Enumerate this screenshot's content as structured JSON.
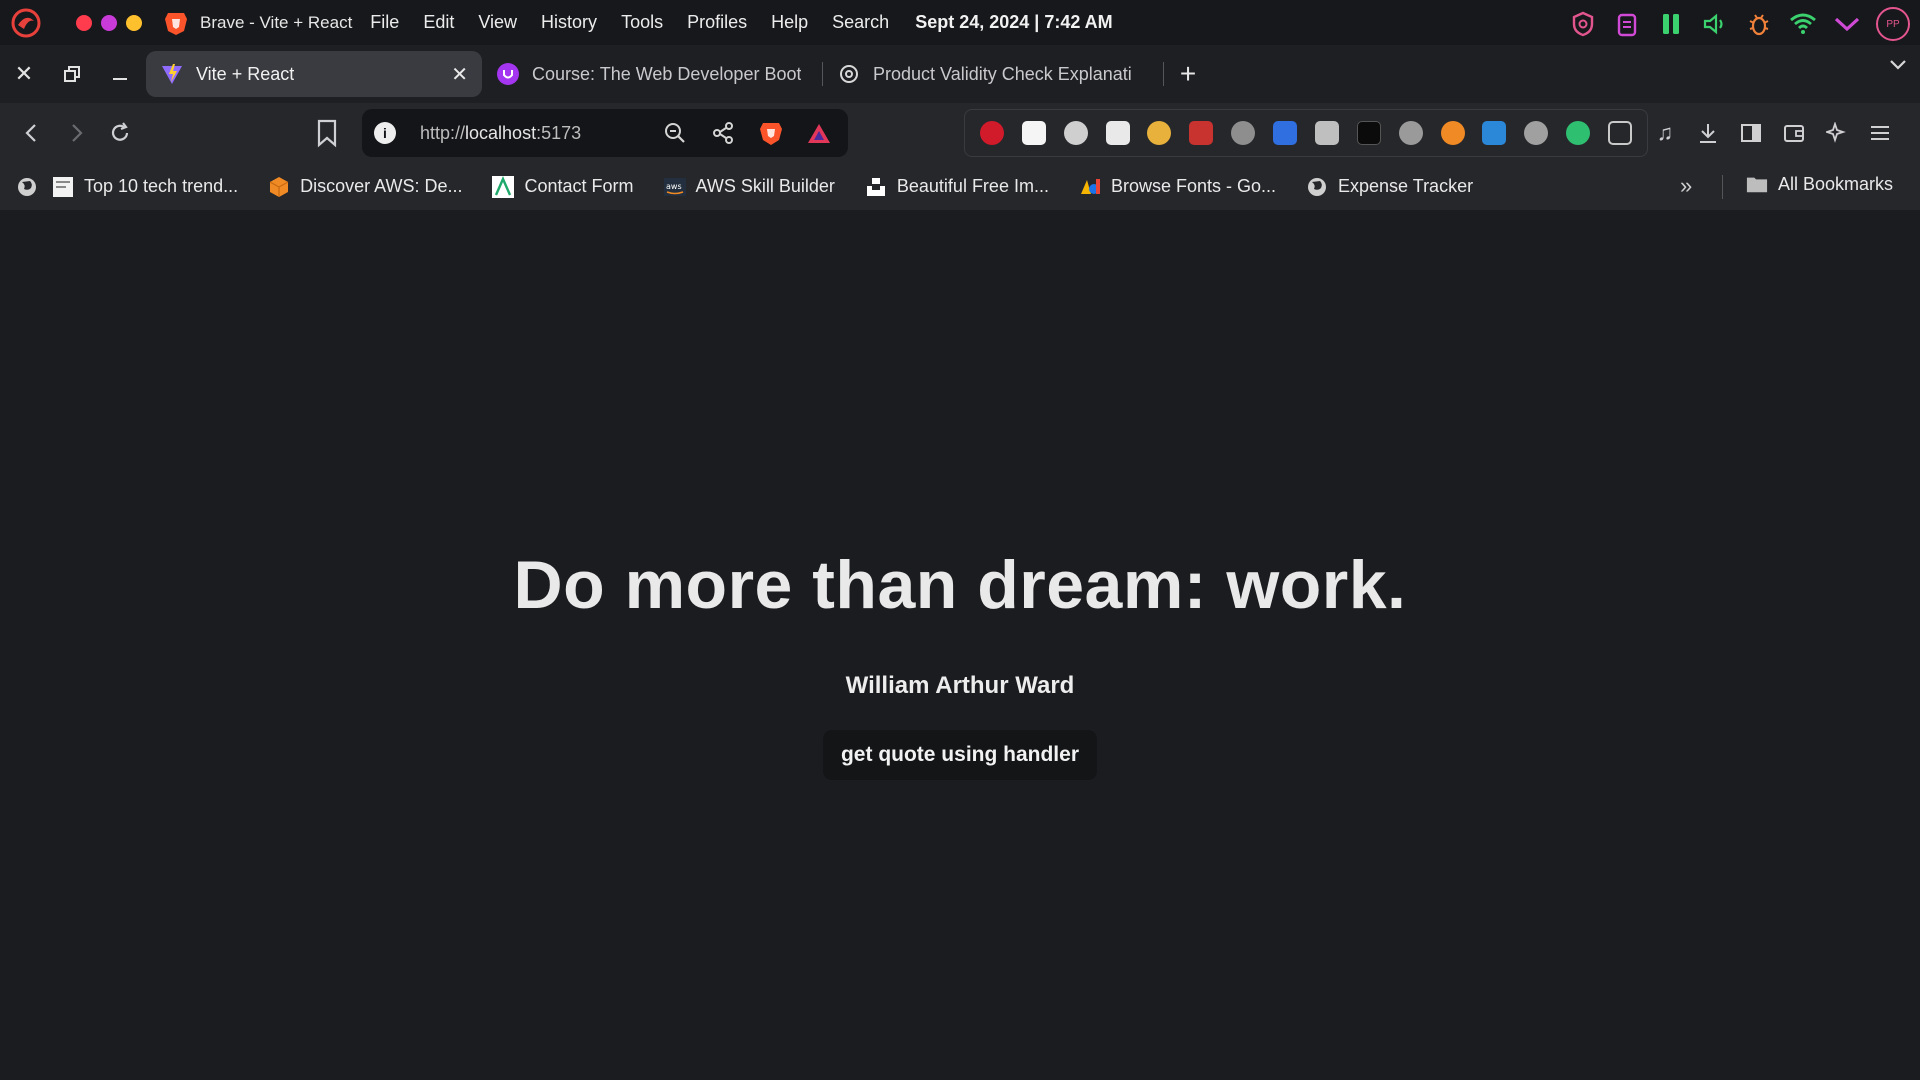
{
  "system_bar": {
    "app_title": "Brave - Vite + React",
    "menu": [
      "File",
      "Edit",
      "View",
      "History",
      "Tools",
      "Profiles",
      "Help",
      "Search"
    ],
    "clock": "Sept 24, 2024 | 7:42 AM",
    "avatar_initials": "PP"
  },
  "tabs": [
    {
      "title": "Vite + React",
      "active": true,
      "close": "✕"
    },
    {
      "title": "Course: The Web Developer Boot",
      "active": false
    },
    {
      "title": "Product Validity Check Explanati",
      "active": false
    }
  ],
  "new_tab_label": "+",
  "address_bar": {
    "scheme": "http://",
    "host": "localhost",
    "port": ":5173"
  },
  "bookmarks": [
    {
      "label": "Top 10 tech trend..."
    },
    {
      "label": "Discover AWS: De..."
    },
    {
      "label": "Contact Form"
    },
    {
      "label": "AWS Skill Builder"
    },
    {
      "label": "Beautiful Free Im..."
    },
    {
      "label": "Browse Fonts - Go..."
    },
    {
      "label": "Expense Tracker"
    }
  ],
  "all_bookmarks_label": "All Bookmarks",
  "page": {
    "quote": "Do more than dream: work.",
    "author": "William Arthur Ward",
    "button_label": "get quote using handler"
  },
  "colors": {
    "page_background": "#1b1c1f",
    "toolbar_background": "#26272b",
    "button_background": "#141517"
  }
}
